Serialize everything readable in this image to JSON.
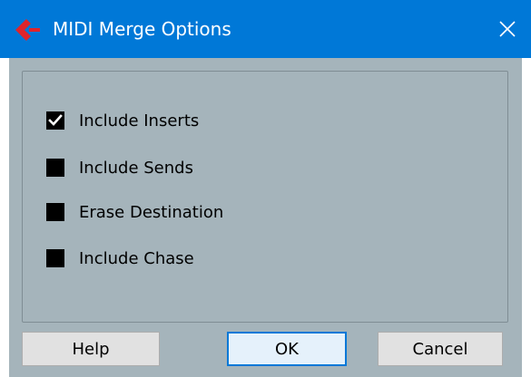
{
  "window": {
    "title": "MIDI Merge Options",
    "app_icon": "cubase-logo-icon",
    "close_icon": "close-icon"
  },
  "options": [
    {
      "label": "Include Inserts",
      "checked": true
    },
    {
      "label": "Include Sends",
      "checked": false
    },
    {
      "label": "Erase Destination",
      "checked": false
    },
    {
      "label": "Include Chase",
      "checked": false
    }
  ],
  "buttons": {
    "help": "Help",
    "ok": "OK",
    "cancel": "Cancel"
  },
  "colors": {
    "titlebar": "#0078d7",
    "client": "#a5b4bb",
    "checkbox": "#000000",
    "logo": "#e0242b"
  }
}
